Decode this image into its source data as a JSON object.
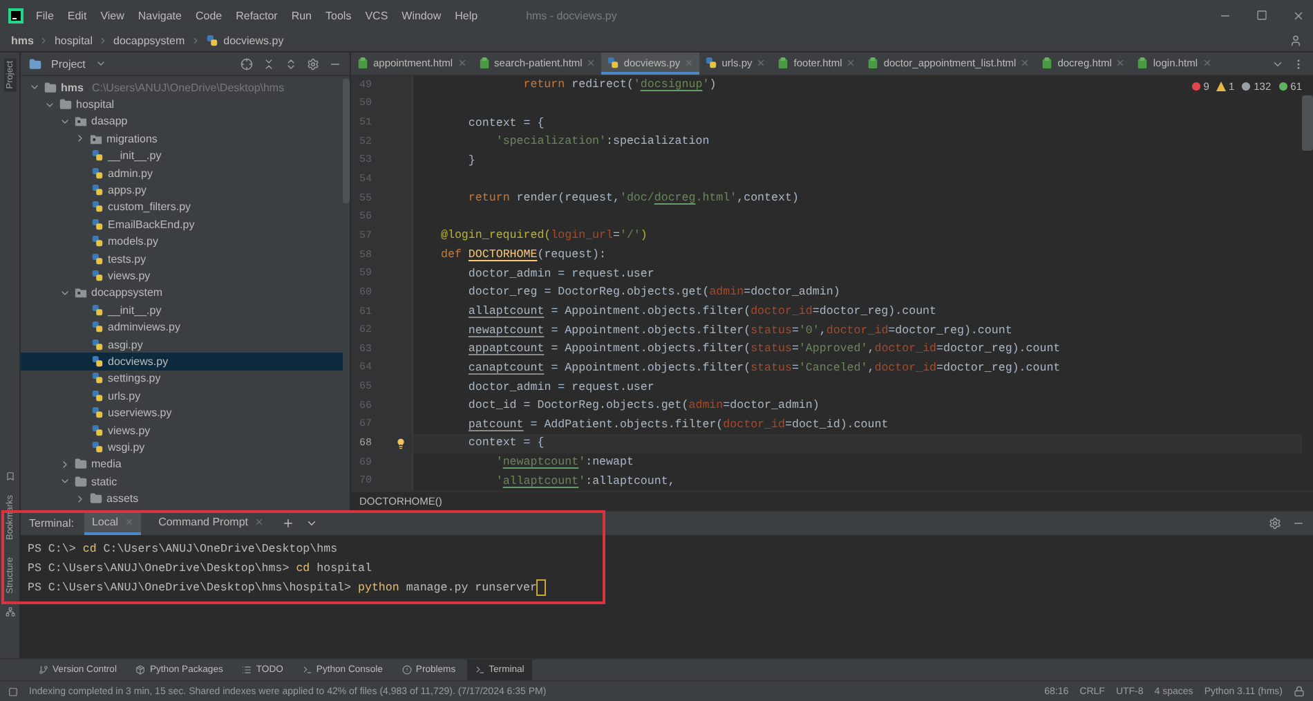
{
  "window": {
    "title": "hms - docviews.py"
  },
  "menu": [
    "File",
    "Edit",
    "View",
    "Navigate",
    "Code",
    "Refactor",
    "Run",
    "Tools",
    "VCS",
    "Window",
    "Help"
  ],
  "breadcrumb": [
    "hms",
    "hospital",
    "docappsystem",
    "docviews.py"
  ],
  "side_strip": {
    "top": [
      {
        "label": "Project",
        "selected": true
      }
    ],
    "bottom": [
      {
        "label": "Bookmarks",
        "selected": false
      },
      {
        "label": "Structure",
        "selected": false
      }
    ]
  },
  "project": {
    "title": "Project",
    "tree": [
      {
        "name": "hms",
        "path": "C:\\Users\\ANUJ\\OneDrive\\Desktop\\hms",
        "kind": "folder",
        "expanded": true,
        "selected": false,
        "children": [
          {
            "name": "hospital",
            "kind": "folder",
            "expanded": true,
            "selected": false,
            "children": [
              {
                "name": "dasapp",
                "kind": "package",
                "expanded": true,
                "selected": false,
                "children": [
                  {
                    "name": "migrations",
                    "kind": "package",
                    "expanded": false,
                    "selected": false
                  },
                  {
                    "name": "__init__.py",
                    "kind": "python",
                    "selected": false
                  },
                  {
                    "name": "admin.py",
                    "kind": "python",
                    "selected": false
                  },
                  {
                    "name": "apps.py",
                    "kind": "python",
                    "selected": false
                  },
                  {
                    "name": "custom_filters.py",
                    "kind": "python",
                    "selected": false
                  },
                  {
                    "name": "EmailBackEnd.py",
                    "kind": "python",
                    "selected": false
                  },
                  {
                    "name": "models.py",
                    "kind": "python",
                    "selected": false
                  },
                  {
                    "name": "tests.py",
                    "kind": "python",
                    "selected": false
                  },
                  {
                    "name": "views.py",
                    "kind": "python",
                    "selected": false
                  }
                ]
              },
              {
                "name": "docappsystem",
                "kind": "package",
                "expanded": true,
                "selected": false,
                "children": [
                  {
                    "name": "__init__.py",
                    "kind": "python",
                    "selected": false
                  },
                  {
                    "name": "adminviews.py",
                    "kind": "python",
                    "selected": false
                  },
                  {
                    "name": "asgi.py",
                    "kind": "python",
                    "selected": false
                  },
                  {
                    "name": "docviews.py",
                    "kind": "python",
                    "selected": true
                  },
                  {
                    "name": "settings.py",
                    "kind": "python",
                    "selected": false
                  },
                  {
                    "name": "urls.py",
                    "kind": "python",
                    "selected": false
                  },
                  {
                    "name": "userviews.py",
                    "kind": "python",
                    "selected": false
                  },
                  {
                    "name": "views.py",
                    "kind": "python",
                    "selected": false
                  },
                  {
                    "name": "wsgi.py",
                    "kind": "python",
                    "selected": false
                  }
                ]
              },
              {
                "name": "media",
                "kind": "folder",
                "expanded": false,
                "selected": false
              },
              {
                "name": "static",
                "kind": "folder",
                "expanded": true,
                "selected": false,
                "children": [
                  {
                    "name": "assets",
                    "kind": "folder",
                    "expanded": false,
                    "selected": false
                  }
                ]
              }
            ]
          }
        ]
      }
    ]
  },
  "editor_tabs": [
    {
      "label": "appointment.html",
      "kind": "html",
      "selected": false
    },
    {
      "label": "search-patient.html",
      "kind": "html",
      "selected": false
    },
    {
      "label": "docviews.py",
      "kind": "python",
      "selected": true
    },
    {
      "label": "urls.py",
      "kind": "python",
      "selected": false
    },
    {
      "label": "footer.html",
      "kind": "html",
      "selected": false
    },
    {
      "label": "doctor_appointment_list.html",
      "kind": "html",
      "selected": false
    },
    {
      "label": "docreg.html",
      "kind": "html",
      "selected": false
    },
    {
      "label": "login.html",
      "kind": "html",
      "selected": false
    }
  ],
  "inspections": [
    {
      "kind": "error",
      "count": "9"
    },
    {
      "kind": "warning",
      "count": "1"
    },
    {
      "kind": "weak",
      "count": "132"
    },
    {
      "kind": "typo",
      "count": "61"
    }
  ],
  "code": [
    {
      "number": "49",
      "current": false,
      "tokens": [
        {
          "kind": "keyword",
          "text": "            return"
        },
        {
          "kind": "plain",
          "text": " redirect("
        },
        {
          "kind": "string",
          "text": "'"
        },
        {
          "kind": "string-typo",
          "text": "docsignup"
        },
        {
          "kind": "string",
          "text": "'"
        },
        {
          "kind": "plain",
          "text": ")"
        }
      ]
    },
    {
      "number": "50",
      "current": false
    },
    {
      "number": "51",
      "current": false,
      "tokens": [
        {
          "kind": "plain",
          "text": "    context = {"
        }
      ]
    },
    {
      "number": "52",
      "current": false,
      "tokens": [
        {
          "kind": "string",
          "text": "        'specialization'"
        },
        {
          "kind": "plain",
          "text": ":specialization"
        }
      ]
    },
    {
      "number": "53",
      "current": false,
      "tokens": [
        {
          "kind": "plain",
          "text": "    }"
        }
      ]
    },
    {
      "number": "54",
      "current": false
    },
    {
      "number": "55",
      "current": false,
      "tokens": [
        {
          "kind": "keyword",
          "text": "    return"
        },
        {
          "kind": "plain",
          "text": " render(request,"
        },
        {
          "kind": "string",
          "text": "'doc/"
        },
        {
          "kind": "string-typo",
          "text": "docreg"
        },
        {
          "kind": "string",
          "text": ".html'"
        },
        {
          "kind": "plain",
          "text": ",context)"
        }
      ]
    },
    {
      "number": "56",
      "current": false
    },
    {
      "number": "57",
      "current": false,
      "tokens": [
        {
          "kind": "decorator",
          "text": "@login_required("
        },
        {
          "kind": "argument",
          "text": "login_url"
        },
        {
          "kind": "plain",
          "text": "="
        },
        {
          "kind": "string",
          "text": "'/'"
        },
        {
          "kind": "decorator",
          "text": ")"
        }
      ]
    },
    {
      "number": "58",
      "current": false,
      "tokens": [
        {
          "kind": "keyword",
          "text": "def "
        },
        {
          "kind": "function",
          "text": "DOCTORHOME"
        },
        {
          "kind": "plain",
          "text": "(request):"
        }
      ]
    },
    {
      "number": "59",
      "current": false,
      "tokens": [
        {
          "kind": "plain",
          "text": "    doctor_admin = request.user"
        }
      ]
    },
    {
      "number": "60",
      "current": false,
      "tokens": [
        {
          "kind": "plain",
          "text": "    doctor_reg = DoctorReg.objects.get("
        },
        {
          "kind": "argument",
          "text": "admin"
        },
        {
          "kind": "plain",
          "text": "=doctor_admin)"
        }
      ]
    },
    {
      "number": "61",
      "current": false,
      "tokens": [
        {
          "kind": "weak",
          "text": "    allaptcount"
        },
        {
          "kind": "plain",
          "text": " = Appointment.objects.filter("
        },
        {
          "kind": "argument",
          "text": "doctor_id"
        },
        {
          "kind": "plain",
          "text": "=doctor_reg).count"
        }
      ]
    },
    {
      "number": "62",
      "current": false,
      "tokens": [
        {
          "kind": "weak",
          "text": "    newaptcount"
        },
        {
          "kind": "plain",
          "text": " = Appointment.objects.filter("
        },
        {
          "kind": "argument",
          "text": "status"
        },
        {
          "kind": "plain",
          "text": "="
        },
        {
          "kind": "string",
          "text": "'0'"
        },
        {
          "kind": "plain",
          "text": ","
        },
        {
          "kind": "argument",
          "text": "doctor_id"
        },
        {
          "kind": "plain",
          "text": "=doctor_reg).count"
        }
      ]
    },
    {
      "number": "63",
      "current": false,
      "tokens": [
        {
          "kind": "weak",
          "text": "    appaptcount"
        },
        {
          "kind": "plain",
          "text": " = Appointment.objects.filter("
        },
        {
          "kind": "argument",
          "text": "status"
        },
        {
          "kind": "plain",
          "text": "="
        },
        {
          "kind": "string",
          "text": "'Approved'"
        },
        {
          "kind": "plain",
          "text": ","
        },
        {
          "kind": "argument",
          "text": "doctor_id"
        },
        {
          "kind": "plain",
          "text": "=doctor_reg).count"
        }
      ]
    },
    {
      "number": "64",
      "current": false,
      "tokens": [
        {
          "kind": "weak",
          "text": "    canaptcount"
        },
        {
          "kind": "plain",
          "text": " = Appointment.objects.filter("
        },
        {
          "kind": "argument",
          "text": "status"
        },
        {
          "kind": "plain",
          "text": "="
        },
        {
          "kind": "string",
          "text": "'Canceled'"
        },
        {
          "kind": "plain",
          "text": ","
        },
        {
          "kind": "argument",
          "text": "doctor_id"
        },
        {
          "kind": "plain",
          "text": "=doctor_reg).count"
        }
      ]
    },
    {
      "number": "65",
      "current": false,
      "tokens": [
        {
          "kind": "plain",
          "text": "    doctor_admin = request.user"
        }
      ]
    },
    {
      "number": "66",
      "current": false,
      "tokens": [
        {
          "kind": "plain",
          "text": "    doct_id = DoctorReg.objects.get("
        },
        {
          "kind": "argument",
          "text": "admin"
        },
        {
          "kind": "plain",
          "text": "=doctor_admin)"
        }
      ]
    },
    {
      "number": "67",
      "current": false,
      "tokens": [
        {
          "kind": "weak",
          "text": "    patcount"
        },
        {
          "kind": "plain",
          "text": " = AddPatient.objects.filter("
        },
        {
          "kind": "argument",
          "text": "doctor_id"
        },
        {
          "kind": "plain",
          "text": "=doct_id).count"
        }
      ]
    },
    {
      "number": "68",
      "current": true,
      "tokens": [
        {
          "kind": "plain",
          "text": "    context = {"
        }
      ]
    },
    {
      "number": "69",
      "current": false,
      "tokens": [
        {
          "kind": "string",
          "text": "        '"
        },
        {
          "kind": "string-typo",
          "text": "newaptcount"
        },
        {
          "kind": "string",
          "text": "'"
        },
        {
          "kind": "plain",
          "text": ":newapt"
        }
      ]
    },
    {
      "number": "70",
      "current": false,
      "tokens": [
        {
          "kind": "string",
          "text": "        '"
        },
        {
          "kind": "string-typo",
          "text": "allaptcount"
        },
        {
          "kind": "string",
          "text": "'"
        },
        {
          "kind": "plain",
          "text": ":allaptcount,"
        }
      ]
    }
  ],
  "code_breadcrumb": "DOCTORHOME()",
  "terminal": {
    "label": "Terminal:",
    "tabs": [
      {
        "label": "Local",
        "selected": true
      },
      {
        "label": "Command Prompt",
        "selected": false
      }
    ],
    "lines": [
      {
        "prompt": "PS C:\\>",
        "command": "cd",
        "args": "C:\\Users\\ANUJ\\OneDrive\\Desktop\\hms",
        "cursor": false
      },
      {
        "prompt": "PS C:\\Users\\ANUJ\\OneDrive\\Desktop\\hms>",
        "command": "cd",
        "args": "hospital",
        "cursor": false
      },
      {
        "prompt": "PS C:\\Users\\ANUJ\\OneDrive\\Desktop\\hms\\hospital>",
        "command": "python",
        "args": "manage.py runserver",
        "cursor": true
      }
    ]
  },
  "tool_windows": [
    {
      "label": "Version Control",
      "selected": false
    },
    {
      "label": "Python Packages",
      "selected": false
    },
    {
      "label": "TODO",
      "selected": false
    },
    {
      "label": "Python Console",
      "selected": false
    },
    {
      "label": "Problems",
      "selected": false
    },
    {
      "label": "Terminal",
      "selected": true
    }
  ],
  "status_bar": {
    "message": "Indexing completed in 3 min, 15 sec. Shared indexes were applied to 42% of files (4,983 of 11,729). (7/17/2024 6:35 PM)",
    "items": [
      "68:16",
      "CRLF",
      "UTF-8",
      "4 spaces",
      "Python 3.11 (hms)"
    ]
  }
}
